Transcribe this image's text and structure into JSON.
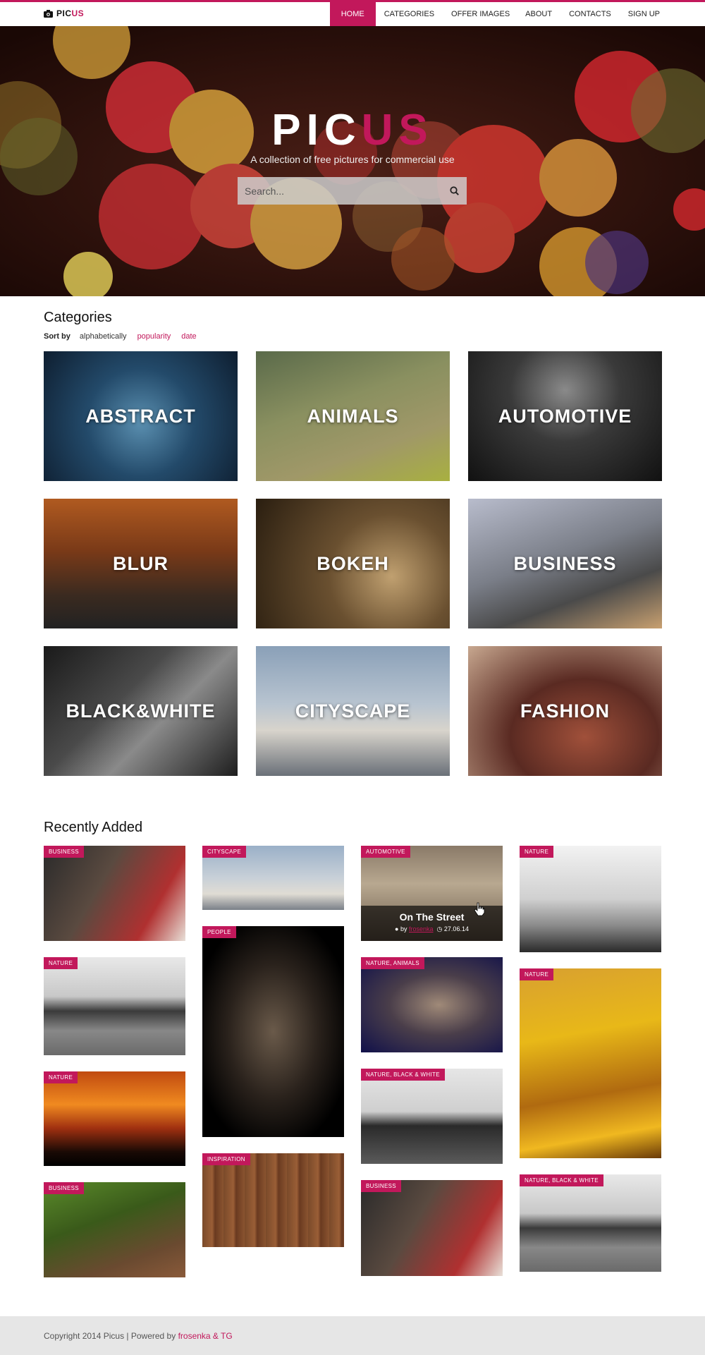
{
  "brand": {
    "pic": "PIC",
    "us": "US"
  },
  "nav": [
    {
      "label": "HOME",
      "active": true
    },
    {
      "label": "CATEGORIES"
    },
    {
      "label": "OFFER IMAGES"
    },
    {
      "label": "ABOUT"
    },
    {
      "label": "CONTACTS"
    },
    {
      "label": "SIGN UP"
    }
  ],
  "hero": {
    "title_pic": "PIC",
    "title_us": "US",
    "subtitle": "A collection of free pictures for commercial use",
    "search_placeholder": "Search..."
  },
  "categories": {
    "heading": "Categories",
    "sort_label": "Sort by",
    "sort_options": [
      "alphabetically",
      "popularity",
      "date"
    ],
    "tiles": [
      "ABSTRACT",
      "ANIMALS",
      "AUTOMOTIVE",
      "BLUR",
      "BOKEH",
      "BUSINESS",
      "BLACK&WHITE",
      "CITYSCAPE",
      "FASHION"
    ]
  },
  "recent": {
    "heading": "Recently Added",
    "col1": [
      "BUSINESS",
      "NATURE",
      "NATURE",
      "BUSINESS"
    ],
    "col2": [
      "CITYSCAPE",
      "PEOPLE",
      "INSPIRATION"
    ],
    "col3": [
      "AUTOMOTIVE",
      "NATURE, ANIMALS",
      "NATURE, BLACK & WHITE",
      "BUSINESS"
    ],
    "col4": [
      "NATURE",
      "NATURE",
      "NATURE, BLACK & WHITE"
    ],
    "hover": {
      "title": "On The Street",
      "by": "by",
      "author": "frosenka",
      "date": "27.06.14"
    }
  },
  "footer": {
    "text": "Copyright 2014 Picus | Powered by",
    "link": "frosenka & TG"
  },
  "colors": {
    "accent": "#c2185b"
  }
}
